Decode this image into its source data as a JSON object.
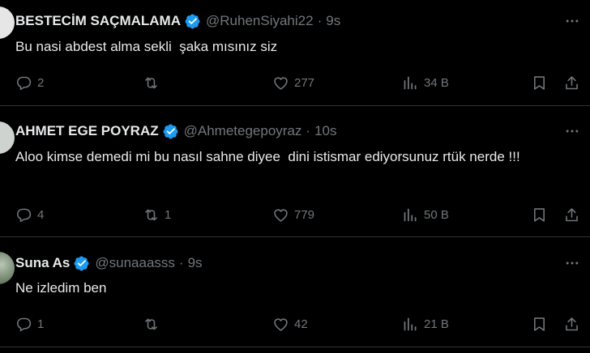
{
  "colors": {
    "background": "#000000",
    "text": "#e7e9ea",
    "muted": "#71767b",
    "divider": "#2f3336",
    "verified": "#1d9bf0"
  },
  "icons": {
    "reply": "reply-icon",
    "retweet": "retweet-icon",
    "like": "heart-icon",
    "views": "views-icon",
    "bookmark": "bookmark-icon",
    "share": "share-icon",
    "more": "more-icon",
    "verified": "verified-badge-icon"
  },
  "tweets": [
    {
      "name": "BESTECİM SAÇMALAMA",
      "handle": "@RuhenSiyahi22",
      "separator": "·",
      "time": "9s",
      "text": "Bu nasi abdest alma sekli  şaka mısınız siz",
      "replies": "2",
      "retweets": "",
      "likes": "277",
      "views": "34 B"
    },
    {
      "name": "AHMET EGE POYRAZ",
      "handle": "@Ahmetegepoyraz",
      "separator": "·",
      "time": "10s",
      "text": "Aloo kimse demedi mi bu nasıl sahne diyee  dini istismar ediyorsunuz rtük nerde !!!",
      "replies": "4",
      "retweets": "1",
      "likes": "779",
      "views": "50 B"
    },
    {
      "name": "Suna As",
      "handle": "@sunaaasss",
      "separator": "·",
      "time": "9s",
      "text": "Ne izledim ben",
      "replies": "1",
      "retweets": "",
      "likes": "42",
      "views": "21 B"
    }
  ]
}
